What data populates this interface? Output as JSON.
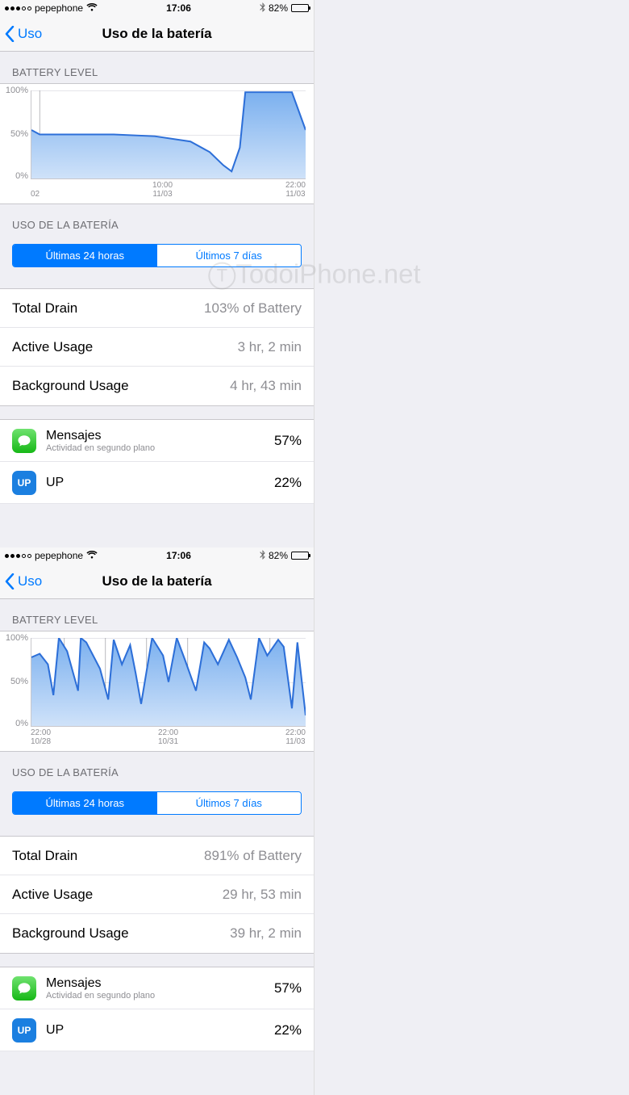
{
  "status": {
    "carrier": "pepephone",
    "time": "17:06",
    "battery_pct": "82%",
    "battery_fill": 82
  },
  "nav": {
    "back_label": "Uso",
    "title": "Uso de la batería"
  },
  "section_battery_level": "BATTERY LEVEL",
  "section_battery_usage": "USO DE LA BATERÍA",
  "segmented": {
    "last24": "Últimas 24 horas",
    "last7": "Últimos 7 días"
  },
  "watermark": "TodoiPhone.net",
  "chart_data": [
    {
      "type": "area",
      "title": "BATTERY LEVEL",
      "ylabel": "%",
      "ylim": [
        0,
        100
      ],
      "y_ticks": [
        "100%",
        "50%",
        "0%"
      ],
      "x_ticks": [
        {
          "top": "",
          "bottom": "02"
        },
        {
          "top": "10:00",
          "bottom": "11/03"
        },
        {
          "top": "22:00",
          "bottom": "11/03"
        }
      ],
      "x": [
        0,
        3,
        5,
        30,
        45,
        58,
        65,
        70,
        73,
        76,
        78,
        95,
        100
      ],
      "values": [
        55,
        50,
        50,
        50,
        48,
        42,
        30,
        15,
        8,
        35,
        98,
        98,
        55
      ],
      "vlines": [
        3
      ]
    },
    {
      "type": "area",
      "title": "BATTERY LEVEL",
      "ylabel": "%",
      "ylim": [
        0,
        100
      ],
      "y_ticks": [
        "100%",
        "50%",
        "0%"
      ],
      "x_ticks": [
        {
          "top": "22:00",
          "bottom": "10/28"
        },
        {
          "top": "22:00",
          "bottom": "10/31"
        },
        {
          "top": "22:00",
          "bottom": "11/03"
        }
      ],
      "x": [
        0,
        3,
        6,
        8,
        10,
        13,
        17,
        18,
        20,
        25,
        28,
        30,
        33,
        36,
        38,
        40,
        44,
        48,
        50,
        53,
        56,
        60,
        63,
        65,
        68,
        72,
        75,
        78,
        80,
        83,
        86,
        90,
        92,
        95,
        97,
        100
      ],
      "values": [
        78,
        82,
        70,
        35,
        100,
        85,
        40,
        100,
        95,
        65,
        30,
        98,
        70,
        92,
        60,
        25,
        100,
        80,
        50,
        100,
        75,
        40,
        95,
        88,
        70,
        98,
        78,
        55,
        30,
        100,
        80,
        98,
        90,
        20,
        95,
        12
      ],
      "vlines": [
        12,
        27,
        42,
        57,
        72,
        87
      ]
    }
  ],
  "screens": [
    {
      "segmented_active": 0,
      "stats": [
        {
          "label": "Total Drain",
          "value": "103% of Battery"
        },
        {
          "label": "Active Usage",
          "value": "3 hr, 2 min"
        },
        {
          "label": "Background Usage",
          "value": "4 hr, 43 min"
        }
      ],
      "apps": [
        {
          "icon": "messages",
          "name": "Mensajes",
          "sub": "Actividad en segundo plano",
          "pct": "57%"
        },
        {
          "icon": "up",
          "name": "UP",
          "sub": "",
          "pct": "22%"
        }
      ]
    },
    {
      "segmented_active": 0,
      "stats": [
        {
          "label": "Total Drain",
          "value": "891% of Battery"
        },
        {
          "label": "Active Usage",
          "value": "29 hr, 53 min"
        },
        {
          "label": "Background Usage",
          "value": "39 hr, 2 min"
        }
      ],
      "apps": [
        {
          "icon": "messages",
          "name": "Mensajes",
          "sub": "Actividad en segundo plano",
          "pct": "57%"
        },
        {
          "icon": "up",
          "name": "UP",
          "sub": "",
          "pct": "22%"
        }
      ]
    }
  ]
}
